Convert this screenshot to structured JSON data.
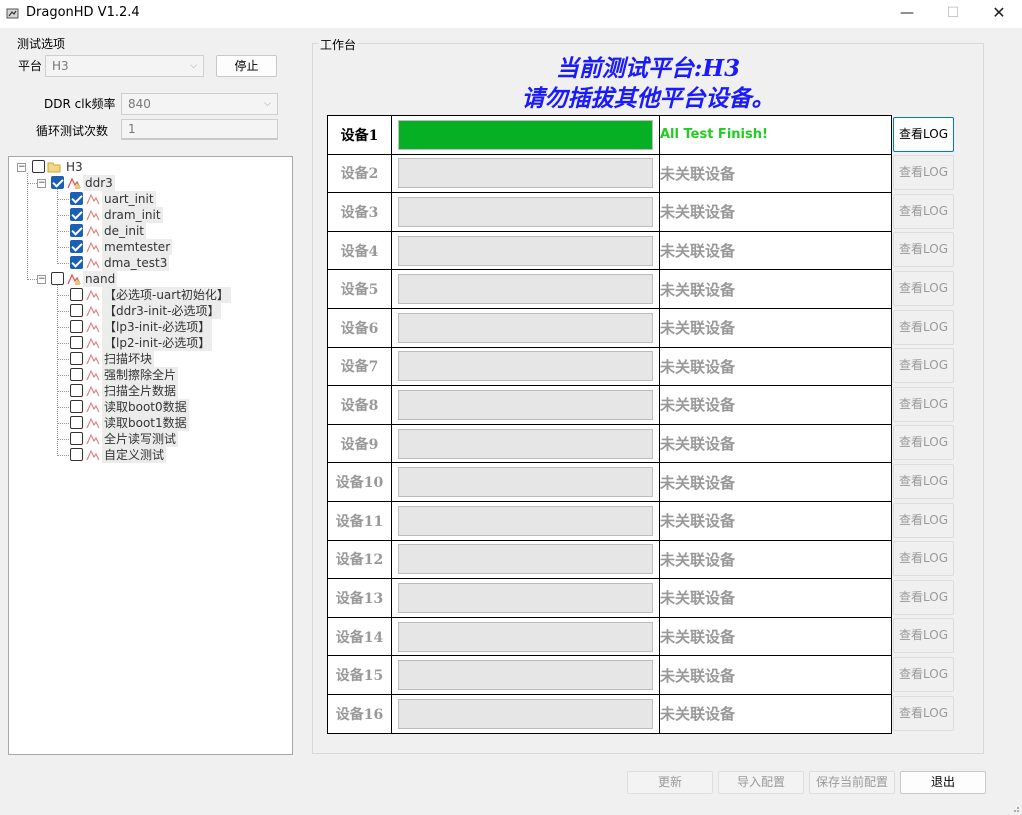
{
  "window": {
    "title": "DragonHD V1.2.4",
    "minimize_glyph": "—",
    "maximize_glyph": "☐",
    "close_glyph": "✕"
  },
  "options": {
    "group_title": "测试选项",
    "platform_label": "平台",
    "platform_value": "H3",
    "stop_button": "停止",
    "ddr_label": "DDR clk频率",
    "ddr_value": "840",
    "loop_label": "循环测试次数",
    "loop_value": "1"
  },
  "tree": {
    "root": {
      "label": "H3",
      "checked": false
    },
    "groups": [
      {
        "label": "ddr3",
        "checked": true,
        "items": [
          {
            "label": "uart_init",
            "checked": true
          },
          {
            "label": "dram_init",
            "checked": true
          },
          {
            "label": "de_init",
            "checked": true
          },
          {
            "label": "memtester",
            "checked": true
          },
          {
            "label": "dma_test3",
            "checked": true
          }
        ]
      },
      {
        "label": "nand",
        "checked": false,
        "items": [
          {
            "label": "【必选项-uart初始化】",
            "checked": false
          },
          {
            "label": "【ddr3-init-必选项】",
            "checked": false
          },
          {
            "label": "【lp3-init-必选项】",
            "checked": false
          },
          {
            "label": "【lp2-init-必选项】",
            "checked": false
          },
          {
            "label": "扫描坏块",
            "checked": false
          },
          {
            "label": "强制擦除全片",
            "checked": false
          },
          {
            "label": "扫描全片数据",
            "checked": false
          },
          {
            "label": "读取boot0数据",
            "checked": false
          },
          {
            "label": "读取boot1数据",
            "checked": false
          },
          {
            "label": "全片读写测试",
            "checked": false
          },
          {
            "label": "自定义测试",
            "checked": false
          }
        ]
      }
    ]
  },
  "workbench": {
    "group_title": "工作台",
    "banner_line1": "当前测试平台:H3",
    "banner_line2": "请勿插拔其他平台设备。",
    "log_button": "查看LOG",
    "devices": [
      {
        "name": "设备1",
        "progress": 1.0,
        "status": "All Test Finish!",
        "active": true
      },
      {
        "name": "设备2",
        "progress": 0,
        "status": "未关联设备",
        "active": false
      },
      {
        "name": "设备3",
        "progress": 0,
        "status": "未关联设备",
        "active": false
      },
      {
        "name": "设备4",
        "progress": 0,
        "status": "未关联设备",
        "active": false
      },
      {
        "name": "设备5",
        "progress": 0,
        "status": "未关联设备",
        "active": false
      },
      {
        "name": "设备6",
        "progress": 0,
        "status": "未关联设备",
        "active": false
      },
      {
        "name": "设备7",
        "progress": 0,
        "status": "未关联设备",
        "active": false
      },
      {
        "name": "设备8",
        "progress": 0,
        "status": "未关联设备",
        "active": false
      },
      {
        "name": "设备9",
        "progress": 0,
        "status": "未关联设备",
        "active": false
      },
      {
        "name": "设备10",
        "progress": 0,
        "status": "未关联设备",
        "active": false
      },
      {
        "name": "设备11",
        "progress": 0,
        "status": "未关联设备",
        "active": false
      },
      {
        "name": "设备12",
        "progress": 0,
        "status": "未关联设备",
        "active": false
      },
      {
        "name": "设备13",
        "progress": 0,
        "status": "未关联设备",
        "active": false
      },
      {
        "name": "设备14",
        "progress": 0,
        "status": "未关联设备",
        "active": false
      },
      {
        "name": "设备15",
        "progress": 0,
        "status": "未关联设备",
        "active": false
      },
      {
        "name": "设备16",
        "progress": 0,
        "status": "未关联设备",
        "active": false
      }
    ]
  },
  "footer": {
    "refresh": "更新",
    "import": "导入配置",
    "save": "保存当前配置",
    "exit": "退出"
  },
  "colors": {
    "banner": "#1a1aff",
    "progress_fill": "#06b025",
    "finish_text": "#22cc22",
    "check_fill": "#1a5fb4"
  }
}
